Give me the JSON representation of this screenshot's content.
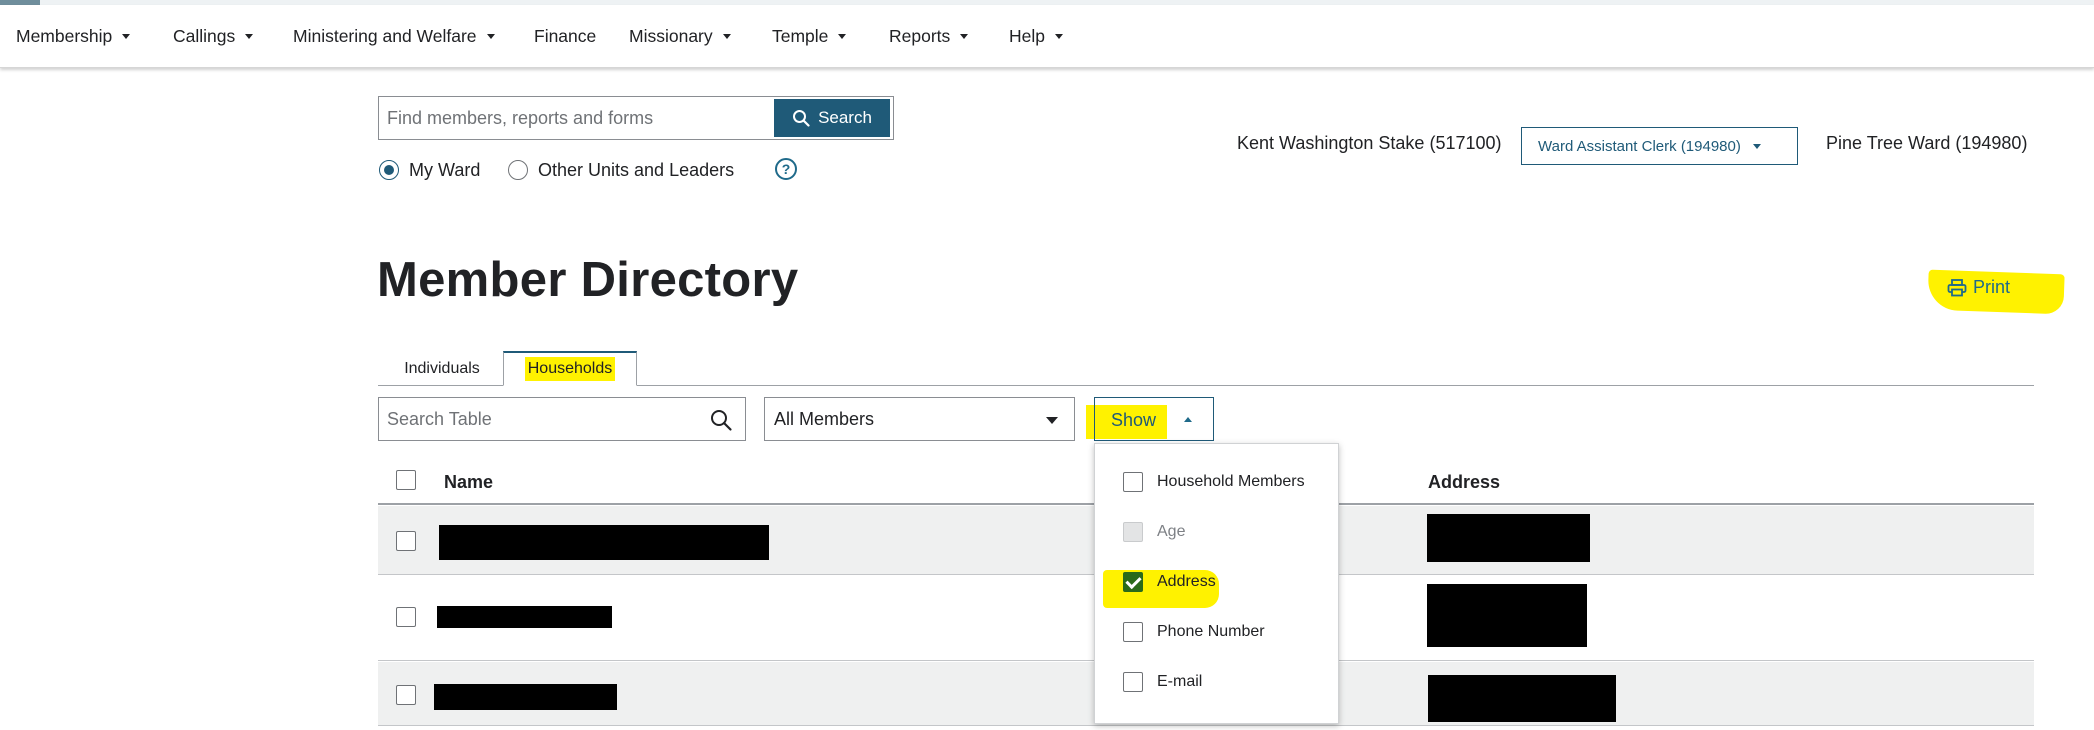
{
  "nav": {
    "items": [
      {
        "label": "Membership",
        "dropdown": true
      },
      {
        "label": "Callings",
        "dropdown": true
      },
      {
        "label": "Ministering and Welfare",
        "dropdown": true
      },
      {
        "label": "Finance",
        "dropdown": false
      },
      {
        "label": "Missionary",
        "dropdown": true
      },
      {
        "label": "Temple",
        "dropdown": true
      },
      {
        "label": "Reports",
        "dropdown": true
      },
      {
        "label": "Help",
        "dropdown": true
      }
    ]
  },
  "search": {
    "placeholder": "Find members, reports and forms",
    "button_label": "Search",
    "scope_options": [
      {
        "label": "My Ward",
        "selected": true
      },
      {
        "label": "Other Units and Leaders",
        "selected": false
      }
    ],
    "help_glyph": "?"
  },
  "unit": {
    "stake": "Kent Washington Stake (517100)",
    "role": "Ward Assistant Clerk (194980)",
    "ward": "Pine Tree Ward (194980)"
  },
  "page": {
    "title": "Member Directory",
    "print_label": "Print"
  },
  "tabs": [
    {
      "label": "Individuals",
      "active": false
    },
    {
      "label": "Households",
      "active": true
    }
  ],
  "filters": {
    "search_placeholder": "Search Table",
    "members_value": "All Members",
    "show_label": "Show"
  },
  "table": {
    "columns": [
      "Name",
      "Address"
    ],
    "row_count": 3
  },
  "show_menu": {
    "options": [
      {
        "label": "Household Members",
        "checked": false,
        "disabled": false
      },
      {
        "label": "Age",
        "checked": false,
        "disabled": true
      },
      {
        "label": "Address",
        "checked": true,
        "disabled": false
      },
      {
        "label": "Phone Number",
        "checked": false,
        "disabled": false
      },
      {
        "label": "E-mail",
        "checked": false,
        "disabled": false
      }
    ]
  },
  "colors": {
    "accent": "#1f5a78",
    "highlight": "#fff200",
    "checked": "#2a6a1a",
    "row_alt": "#eff0f0"
  }
}
